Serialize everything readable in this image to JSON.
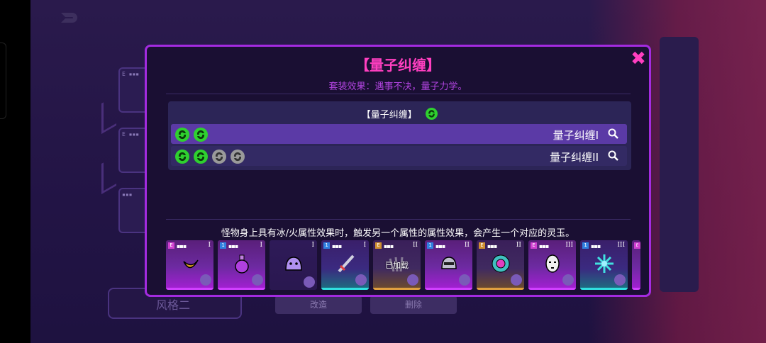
{
  "background": {
    "style_label": "风格二",
    "button_left": "改造",
    "button_right": "删除"
  },
  "modal": {
    "title": "【量子纠缠】",
    "subtitle": "套装效果：遇事不决，量子力学。",
    "set_header": "【量子纠缠】",
    "rows": [
      {
        "name": "量子纠缠I",
        "orbs_active": 2,
        "orbs_total": 2
      },
      {
        "name": "量子纠缠II",
        "orbs_active": 2,
        "orbs_total": 4
      }
    ],
    "description": "怪物身上具有冰/火属性效果时，触发另一个属性的属性效果，会产生一个对应的灵玉。",
    "cards": [
      {
        "tier": "I",
        "badge": "E",
        "rarity": "pink",
        "item": "crescent-item-icon"
      },
      {
        "tier": "I",
        "badge": "1",
        "rarity": "pink",
        "item": "potion-item-icon"
      },
      {
        "tier": "I",
        "badge": "",
        "rarity": "plain",
        "item": "slime-item-icon"
      },
      {
        "tier": "I",
        "badge": "1",
        "rarity": "cyan",
        "item": "sword-item-icon"
      },
      {
        "tier": "II",
        "badge": "E",
        "rarity": "gold",
        "item": "claw-item-icon",
        "overlay": "已加载"
      },
      {
        "tier": "II",
        "badge": "1",
        "rarity": "pink",
        "item": "helmet-item-icon"
      },
      {
        "tier": "II",
        "badge": "E",
        "rarity": "gold",
        "item": "flower-item-icon"
      },
      {
        "tier": "III",
        "badge": "E",
        "rarity": "pink",
        "item": "mask-item-icon"
      },
      {
        "tier": "III",
        "badge": "1",
        "rarity": "cyan",
        "item": "crystal-item-icon"
      }
    ]
  },
  "colors": {
    "accent": "#a32be0",
    "title": "#ff3fc0",
    "orb_active": "#2fd02f",
    "orb_inactive": "#9a9a9a"
  }
}
